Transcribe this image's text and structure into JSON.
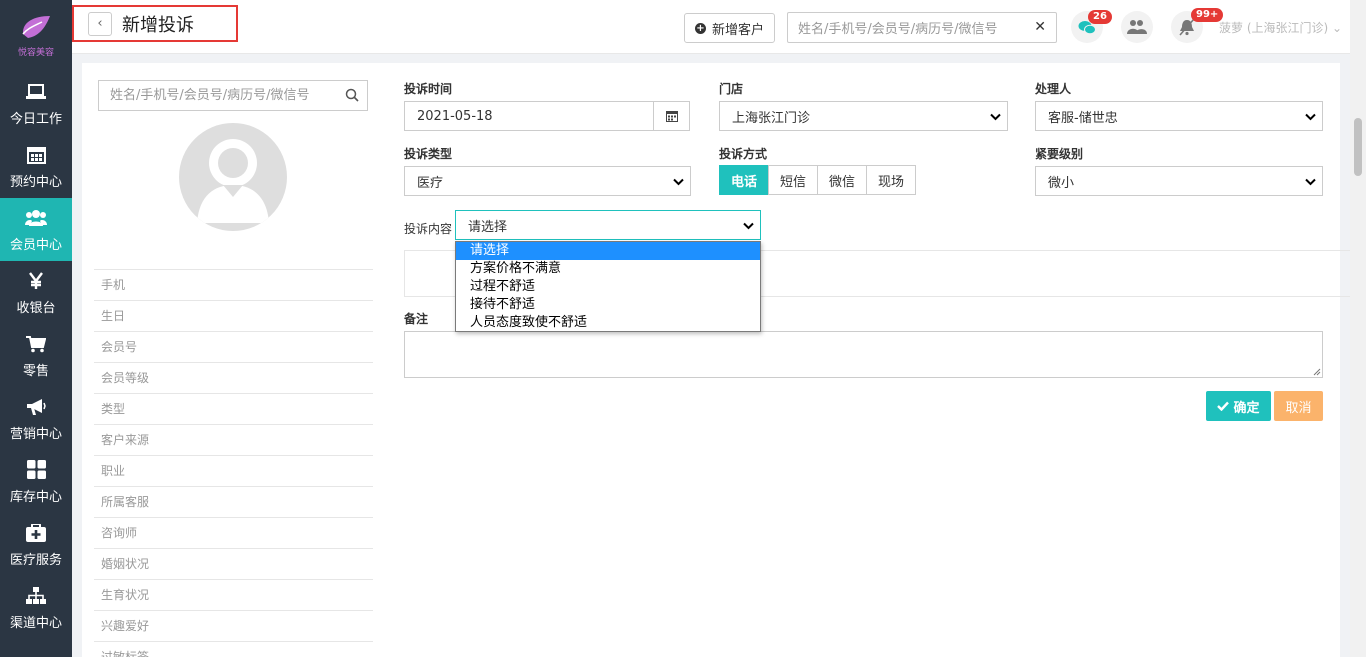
{
  "app": {
    "logo_text": "悦容美容"
  },
  "sidebar": {
    "items": [
      {
        "label": "今日工作",
        "icon": "laptop-icon"
      },
      {
        "label": "预约中心",
        "icon": "calendar-icon"
      },
      {
        "label": "会员中心",
        "icon": "users-icon",
        "active": true
      },
      {
        "label": "收银台",
        "icon": "yen-icon"
      },
      {
        "label": "零售",
        "icon": "cart-icon"
      },
      {
        "label": "营销中心",
        "icon": "megaphone-icon"
      },
      {
        "label": "库存中心",
        "icon": "grid-icon"
      },
      {
        "label": "医疗服务",
        "icon": "medkit-icon"
      },
      {
        "label": "渠道中心",
        "icon": "sitemap-icon"
      }
    ]
  },
  "header": {
    "back_label": "‹",
    "title": "新增投诉",
    "add_customer_label": "新增客户",
    "search_placeholder": "姓名/手机号/会员号/病历号/微信号",
    "clear_label": "✕",
    "wechat_badge": "26",
    "notice_badge": "99+",
    "user_label": "菠萝 (上海张江门诊) ⌄"
  },
  "left_panel": {
    "search_placeholder": "姓名/手机号/会员号/病历号/微信号",
    "fields": [
      "手机",
      "生日",
      "会员号",
      "会员等级",
      "类型",
      "客户来源",
      "职业",
      "所属客服",
      "咨询师",
      "婚姻状况",
      "生育状况",
      "兴趣爱好",
      "过敏标签"
    ]
  },
  "form": {
    "time_label": "投诉时间",
    "time_value": "2021-05-18",
    "store_label": "门店",
    "store_value": "上海张江门诊",
    "handler_label": "处理人",
    "handler_value": "客服-储世忠",
    "type_label": "投诉类型",
    "type_value": "医疗",
    "method_label": "投诉方式",
    "methods": [
      "电话",
      "短信",
      "微信",
      "现场"
    ],
    "method_selected": "电话",
    "urgency_label": "紧要级别",
    "urgency_value": "微小",
    "content_label": "投诉内容",
    "content_value": "请选择",
    "content_options": [
      "请选择",
      "方案价格不满意",
      "过程不舒适",
      "接待不舒适",
      "人员态度致使不舒适"
    ],
    "remark_label": "备注",
    "ok_label": "确定",
    "cancel_label": "取消"
  },
  "colors": {
    "sidebar": "#2b3643",
    "accent": "#1fc1bd",
    "warn": "#fbb36b",
    "badge": "#e53935",
    "highlight_border": "#e53935"
  }
}
